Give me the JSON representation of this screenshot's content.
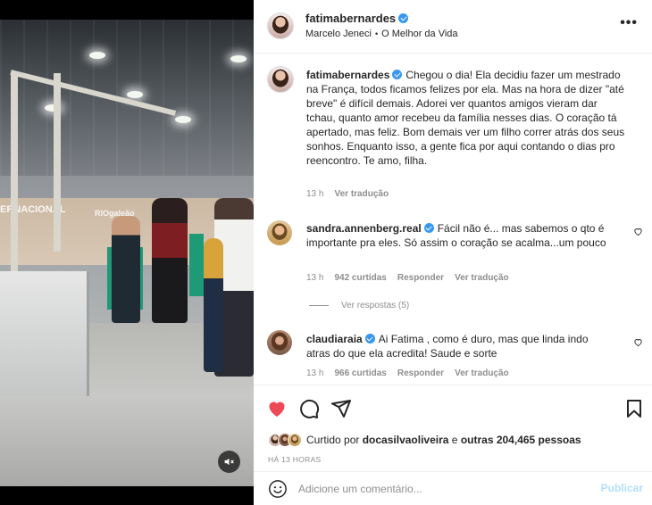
{
  "post": {
    "username": "fatimabernardes",
    "audio": {
      "artist": "Marcelo Jeneci",
      "separator": "•",
      "song": "O Melhor da Vida"
    },
    "caption": {
      "username": "fatimabernardes",
      "text": "Chegou o dia! Ela decidiu fazer um mestrado na França, todos ficamos felizes por ela. Mas na hora de dizer \"até breve\" é difícil demais. Adorei ver quantos amigos vieram dar tchau, quanto amor recebeu da família nesses dias. O coração tá apertado, mas feliz. Bom demais ver um filho correr atrás dos seus sonhos. Enquanto isso, a gente fica por aqui contando o dias pro reencontro. Te amo, filha.",
      "time": "13 h",
      "translate": "Ver tradução"
    },
    "comments": [
      {
        "username": "sandra.annenberg.real",
        "text": "Fácil não é... mas sabemos o qto é importante pra eles. Só assim o coração se acalma...um pouco",
        "time": "13 h",
        "likes": "942 curtidas",
        "reply": "Responder",
        "translate": "Ver tradução",
        "view_replies": "Ver respostas (5)"
      },
      {
        "username": "claudiaraia",
        "text": "Ai Fatima , como é duro, mas que linda indo atras do que ela acredita! Saude e sorte",
        "time": "13 h",
        "likes": "966 curtidas",
        "reply": "Responder",
        "translate": "Ver tradução"
      }
    ],
    "liked_by": {
      "prefix": "Curtido por",
      "user": "docasilvaoliveira",
      "conj": "e",
      "others": "outras 204,465 pessoas"
    },
    "posted_time": "HÁ 13 HORAS",
    "comment_placeholder": "Adicione um comentário...",
    "post_button": "Publicar"
  },
  "video_scene": {
    "sign_left": "ERNACIONAL",
    "sign_right": "RIOgaleão"
  },
  "colors": {
    "like_red": "#ed4956",
    "verified_blue": "#3897f0",
    "publish_disabled": "#b2dffc",
    "muted_text": "#8e8e8e"
  },
  "icons": [
    "heart-icon",
    "comment-icon",
    "share-icon",
    "bookmark-icon",
    "emoji-icon",
    "more-icon",
    "mute-icon",
    "verified-icon"
  ]
}
